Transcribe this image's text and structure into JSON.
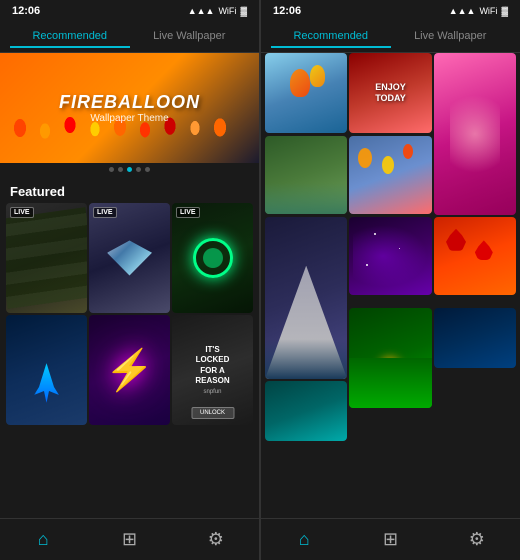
{
  "left_panel": {
    "status_time": "12:06",
    "tabs": [
      {
        "label": "Recommended",
        "active": true
      },
      {
        "label": "Live Wallpaper",
        "active": false
      }
    ],
    "hero": {
      "title": "FIREBALLOON",
      "subtitle": "Wallpaper Theme"
    },
    "dots": [
      false,
      false,
      true,
      false,
      false
    ],
    "featured_label": "Featured",
    "featured_items": [
      {
        "type": "money",
        "live": true
      },
      {
        "type": "diamond",
        "live": true
      },
      {
        "type": "green-circle",
        "live": true
      },
      {
        "type": "blue-flame",
        "live": false
      },
      {
        "type": "lightning",
        "live": false
      },
      {
        "type": "locked",
        "live": false
      }
    ],
    "locked_text": "IT'S LOCKED FOR A REASON",
    "locked_sub": "snpfun",
    "unlock_label": "UNLOCK",
    "nav": [
      {
        "icon": "⌂",
        "label": "home",
        "active": true
      },
      {
        "icon": "⊞",
        "label": "apps",
        "active": false
      },
      {
        "icon": "⚙",
        "label": "settings",
        "active": false
      }
    ]
  },
  "right_panel": {
    "status_time": "12:06",
    "tabs": [
      {
        "label": "Recommended",
        "active": true
      },
      {
        "label": "Live Wallpaper",
        "active": false
      }
    ],
    "nav": [
      {
        "icon": "⌂",
        "label": "home",
        "active": true
      },
      {
        "icon": "⊞",
        "label": "apps",
        "active": false
      },
      {
        "icon": "⚙",
        "label": "settings",
        "active": false
      }
    ],
    "enjoy_text": "ENJOY\nTODAY"
  }
}
